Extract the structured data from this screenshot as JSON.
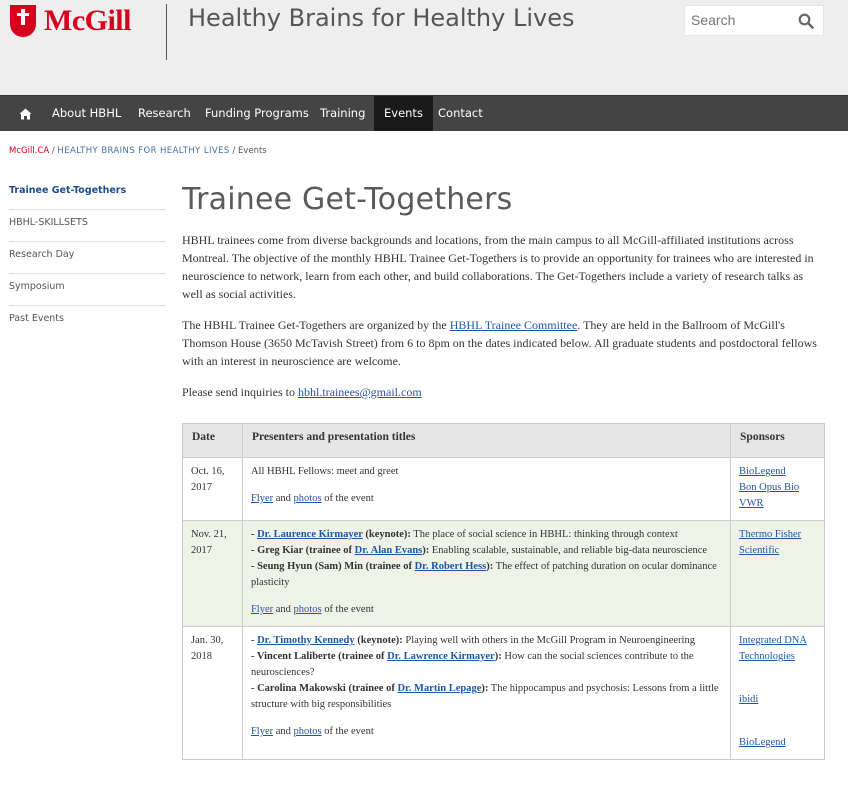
{
  "header": {
    "logo_text": "McGill",
    "site_title": "Healthy Brains for Healthy Lives",
    "search_placeholder": "Search"
  },
  "nav": {
    "items": [
      "About HBHL",
      "Research",
      "Funding Programs",
      "Training",
      "Events",
      "Contact"
    ],
    "active": "Events"
  },
  "breadcrumb": {
    "home": "McGill.CA",
    "site": "HEALTHY BRAINS FOR HEALTHY LIVES",
    "current": "Events",
    "sep": "/"
  },
  "sidebar": {
    "items": [
      "Trainee Get-Togethers",
      "HBHL-SKILLSETS",
      "Research Day",
      "Symposium",
      "Past Events"
    ]
  },
  "main": {
    "title": "Trainee Get-Togethers",
    "p1": "HBHL trainees come from diverse backgrounds and locations, from the main campus to all McGill-affiliated institutions across Montreal. The objective of the monthly HBHL Trainee Get-Togethers is to provide an opportunity for trainees who are interested in neuroscience to network, learn from each other, and build collaborations. The Get-Togethers include a variety of research talks as well as social activities.",
    "p2_a": "The HBHL Trainee Get-Togethers are organized by the ",
    "p2_link": "HBHL Trainee Committee",
    "p2_b": ". They are held in the Ballroom of McGill's Thomson House (3650 McTavish Street) from 6 to 8pm on the dates indicated below. All graduate students and postdoctoral fellows with an interest in neuroscience are welcome.",
    "p3_a": "Please send inquiries to ",
    "p3_link": "hbhl.trainees@gmail.com"
  },
  "table": {
    "headers": [
      "Date",
      "Presenters and presentation titles",
      "Sponsors"
    ],
    "flyer": "Flyer",
    "and": " and ",
    "photos": "photos",
    "of_event": " of the event",
    "rows": [
      {
        "date": "Oct. 16, 2017",
        "text": "All HBHL Fellows: meet and greet",
        "sponsors": [
          "BioLegend",
          "Bon Opus Bio",
          "VWR"
        ]
      },
      {
        "date": "Nov. 21, 2017",
        "l1_dash": "- ",
        "l1_name": "Dr. Laurence Kirmayer",
        "l1_bold": " (keynote):",
        "l1_text": " The place of social science in HBHL: thinking through context",
        "l2_bold_a": "- Greg Kiar (trainee of ",
        "l2_name": "Dr. Alan Evans",
        "l2_bold_b": "):",
        "l2_text": " Enabling scalable, sustainable, and reliable big-data neuroscience",
        "l3_bold_a": "- Seung Hyun (Sam) Min (trainee of ",
        "l3_name": "Dr. Robert Hess",
        "l3_bold_b": "):",
        "l3_text": " The effect of patching duration on ocular dominance plasticity",
        "sponsors": [
          "Thermo Fisher Scientific"
        ]
      },
      {
        "date": "Jan. 30, 2018",
        "l1_dash": "- ",
        "l1_name": "Dr. Timothy Kennedy",
        "l1_bold": " (keynote):",
        "l1_text": " Playing well with others in the McGill Program in Neuroengineering",
        "l2_bold_a": "- Vincent Laliberte (trainee of ",
        "l2_name": "Dr. Lawrence Kirmayer",
        "l2_bold_b": "):",
        "l2_text": " How can the social sciences contribute to the neurosciences?",
        "l3_bold_a": "- Carolina Makowski (trainee of ",
        "l3_name": "Dr. Martin Lepage",
        "l3_bold_b": "):",
        "l3_text": " The hippocampus and psychosis: Lessons from a little structure with big responsibilities",
        "sponsors": [
          "Integrated DNA Technologies",
          "ibidi",
          "BioLegend"
        ]
      }
    ]
  },
  "colors": {
    "brand_red": "#d6001c",
    "nav_bg": "#444444",
    "link": "#2156a5",
    "row_alt": "#eef3e8"
  }
}
